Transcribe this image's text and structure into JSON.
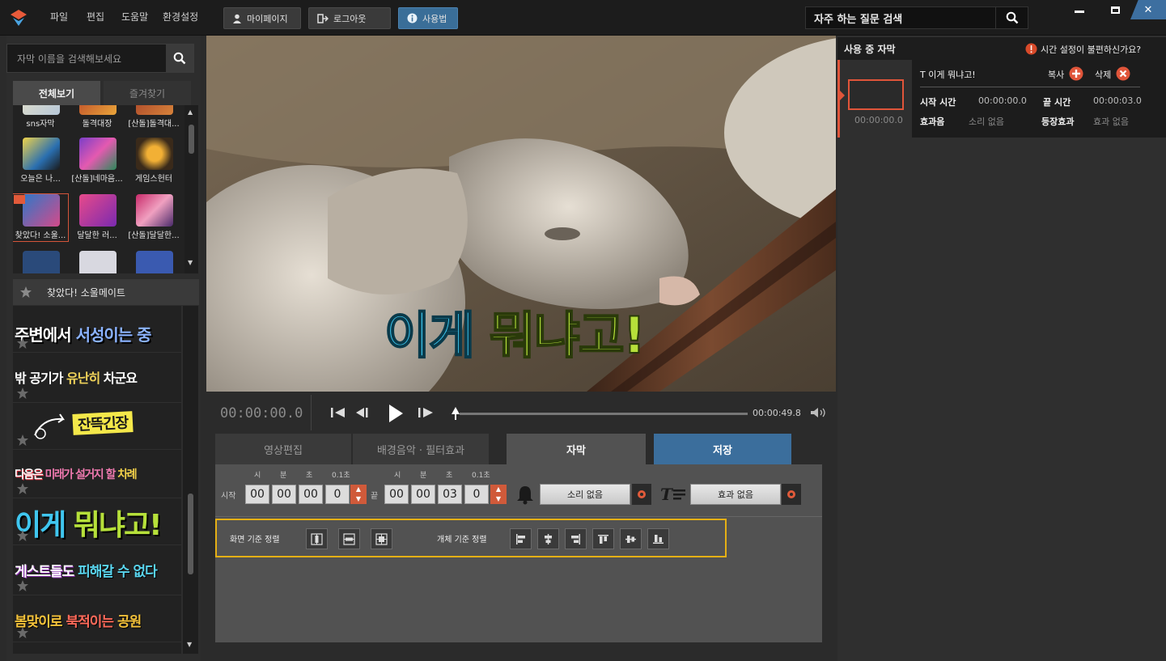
{
  "menu": {
    "items": [
      "파일",
      "편집",
      "도움말",
      "환경설정"
    ]
  },
  "toolbar": {
    "mypage": "마이페이지",
    "logout": "로그아웃",
    "howto": "사용법"
  },
  "faq_search": {
    "label": "자주 하는 질문 검색"
  },
  "library": {
    "search_placeholder": "자막 이름을 검색해보세요",
    "tabs": {
      "all": "전체보기",
      "favorites": "즐겨찾기"
    },
    "items": [
      {
        "label": "sns자막"
      },
      {
        "label": "돌격대장"
      },
      {
        "label": "[산돌]돌격대..."
      },
      {
        "label": "오늘은 나..."
      },
      {
        "label": "[산돌]네마음..."
      },
      {
        "label": "게임스헌터"
      },
      {
        "label": "찾았다! 소울..."
      },
      {
        "label": "달달한 러..."
      },
      {
        "label": "[산돌]달달한..."
      }
    ],
    "selected_title": "찾았다! 소울메이트",
    "styles": [
      {
        "text_a": "주변에서 ",
        "text_b": "서성이는 중"
      },
      {
        "text_a": "밖 공기가 ",
        "text_b": "유난히 ",
        "text_c": "차군요"
      },
      {
        "text_a": "잔뜩긴장"
      },
      {
        "text_a": "다음은 ",
        "text_b": "미래가 설거지 할 ",
        "text_c": "차례"
      },
      {
        "text_a": "이게 ",
        "text_b": "뭐냐고!"
      },
      {
        "text_a": "게스트들도 ",
        "text_b": "피해갈 수 없다"
      },
      {
        "text_a": "봄맞이로 ",
        "text_b": "북적이는 ",
        "text_c": "공원"
      }
    ]
  },
  "preview": {
    "caption_a": "이게 ",
    "caption_b": "뭐냐고!"
  },
  "player": {
    "current_time": "00:00:00.0",
    "total_time": "00:00:49.8"
  },
  "bottom_tabs": {
    "video_edit": "영상편집",
    "bgm_filter": "배경음악 · 필터효과",
    "subtitle": "자막",
    "save": "저장"
  },
  "timing": {
    "units": [
      "시",
      "분",
      "초",
      "0.1초"
    ],
    "start_label": "시작",
    "start": [
      "00",
      "00",
      "00",
      "0"
    ],
    "end_label": "끝",
    "end": [
      "00",
      "00",
      "03",
      "0"
    ],
    "sound": "소리 없음",
    "effect": "효과 없음"
  },
  "align": {
    "screen_label": "화면 기준 정렬",
    "object_label": "개체 기준 정렬"
  },
  "in_use": {
    "title": "사용 중 자막",
    "help": "시간 설정이 불편하신가요?",
    "item_title": "T 이게 뭐냐고!",
    "copy": "복사",
    "delete": "삭제",
    "start_label": "시작 시간",
    "start_value": "00:00:00.0",
    "end_label": "끝 시간",
    "end_value": "00:00:03.0",
    "sfx_label": "효과음",
    "sfx_value": "소리 없음",
    "appear_label": "등장효과",
    "appear_value": "효과 없음",
    "thumb_time": "00:00:00.0"
  }
}
